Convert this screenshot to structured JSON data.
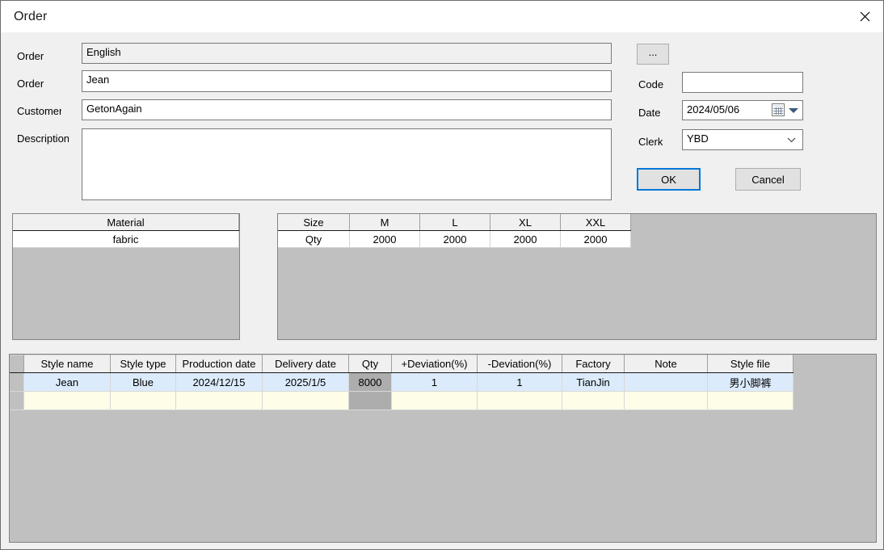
{
  "window": {
    "title": "Order",
    "close_icon": "close-icon"
  },
  "form": {
    "fields": [
      {
        "label": "Order",
        "value": "English",
        "readonly": true
      },
      {
        "label": "Order",
        "value": "Jean",
        "readonly": false
      },
      {
        "label": "Customer",
        "value": "GetonAgain",
        "readonly": false
      },
      {
        "label": "Description",
        "value": "",
        "readonly": false
      }
    ]
  },
  "side": {
    "browse_button": "...",
    "code_label": "Code",
    "code_value": "",
    "date_label": "Date",
    "date_value": "2024/05/06",
    "date_icon": "calendar-icon",
    "clerk_label": "Clerk",
    "clerk_value": "YBD",
    "ok_label": "OK",
    "cancel_label": "Cancel",
    "focus_color": "#0078d7"
  },
  "material_table": {
    "header": "Material",
    "rows": [
      "fabric"
    ]
  },
  "size_table": {
    "headers": [
      "Size",
      "M",
      "L",
      "XL",
      "XXL"
    ],
    "rows": [
      [
        "Qty",
        "2000",
        "2000",
        "2000",
        "2000"
      ]
    ]
  },
  "order_grid": {
    "columns": [
      "Style name",
      "Style type",
      "Production date",
      "Delivery date",
      "Qty",
      "+Deviation(%)",
      "-Deviation(%)",
      "Factory",
      "Note",
      "Style file"
    ],
    "rows": [
      {
        "selected": true,
        "cells": [
          "Jean",
          "Blue",
          "2024/12/15",
          "2025/1/5",
          "8000",
          "1",
          "1",
          "TianJin",
          "",
          "男小脚裤"
        ]
      },
      {
        "selected": false,
        "cells": [
          "",
          "",
          "",
          "",
          "",
          "",
          "",
          "",
          "",
          ""
        ]
      }
    ],
    "selected_row_color": "#dcebfb",
    "empty_row_color": "#fdfde8",
    "readonly_cell_color": "#adadad"
  }
}
